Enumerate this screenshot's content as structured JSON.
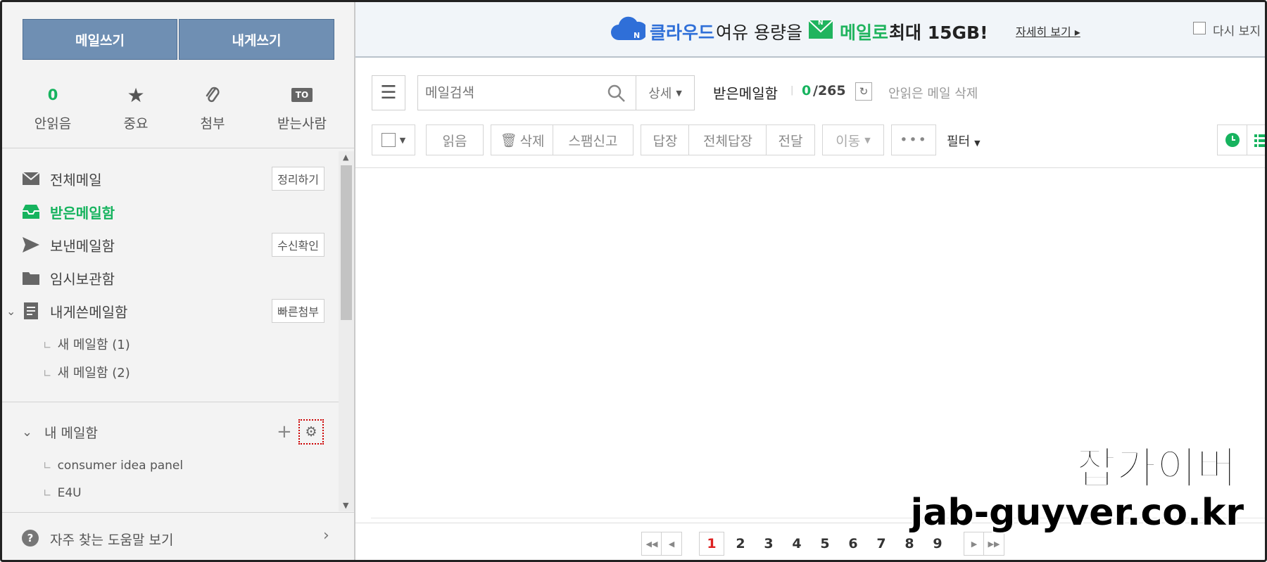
{
  "compose": {
    "write_mail": "메일쓰기",
    "write_self": "내게쓰기"
  },
  "quick": [
    {
      "count": "0",
      "label": "안읽음",
      "icon": "unread-count"
    },
    {
      "icon": "star-icon",
      "label": "중요"
    },
    {
      "icon": "paperclip-icon",
      "label": "첨부"
    },
    {
      "icon": "to-badge-icon",
      "badge": "TO",
      "label": "받는사람"
    }
  ],
  "folders": {
    "all": {
      "label": "전체메일",
      "action": "정리하기"
    },
    "inbox": {
      "label": "받은메일함"
    },
    "sent": {
      "label": "보낸메일함",
      "action": "수신확인"
    },
    "drafts": {
      "label": "임시보관함"
    },
    "self": {
      "label": "내게쓴메일함",
      "action": "빠른첨부"
    },
    "sub": [
      "새 메일함 (1)",
      "새 메일함 (2)"
    ]
  },
  "my_box": {
    "title": "내 메일함",
    "items": [
      "consumer idea panel",
      "E4U"
    ]
  },
  "help": {
    "label": "자주 찾는 도움말 보기"
  },
  "banner": {
    "part1": "클라우드",
    "part2": "여유 용량을",
    "part3": "메일로",
    "part4": "최대 15GB!",
    "details": "자세히 보기",
    "dont_show": "다시 보지 않"
  },
  "search": {
    "placeholder": "메일검색",
    "detail": "상세"
  },
  "mailbox": {
    "name": "받은메일함",
    "unread": "0",
    "total": "/265",
    "delete_unread": "안읽은 메일 삭제"
  },
  "toolbar": {
    "read": "읽음",
    "delete": "삭제",
    "spam": "스팸신고",
    "reply": "답장",
    "reply_all": "전체답장",
    "forward": "전달",
    "move": "이동",
    "more": "•••",
    "filter": "필터"
  },
  "pagination": {
    "pages": [
      "1",
      "2",
      "3",
      "4",
      "5",
      "6",
      "7",
      "8",
      "9"
    ],
    "current": "1"
  },
  "watermark": {
    "line1": "잡가이버",
    "line2": "jab-guyver.co.kr"
  },
  "colors": {
    "accent_green": "#16b35e",
    "compose_blue": "#6f8fb3",
    "current_page_red": "#d22"
  }
}
